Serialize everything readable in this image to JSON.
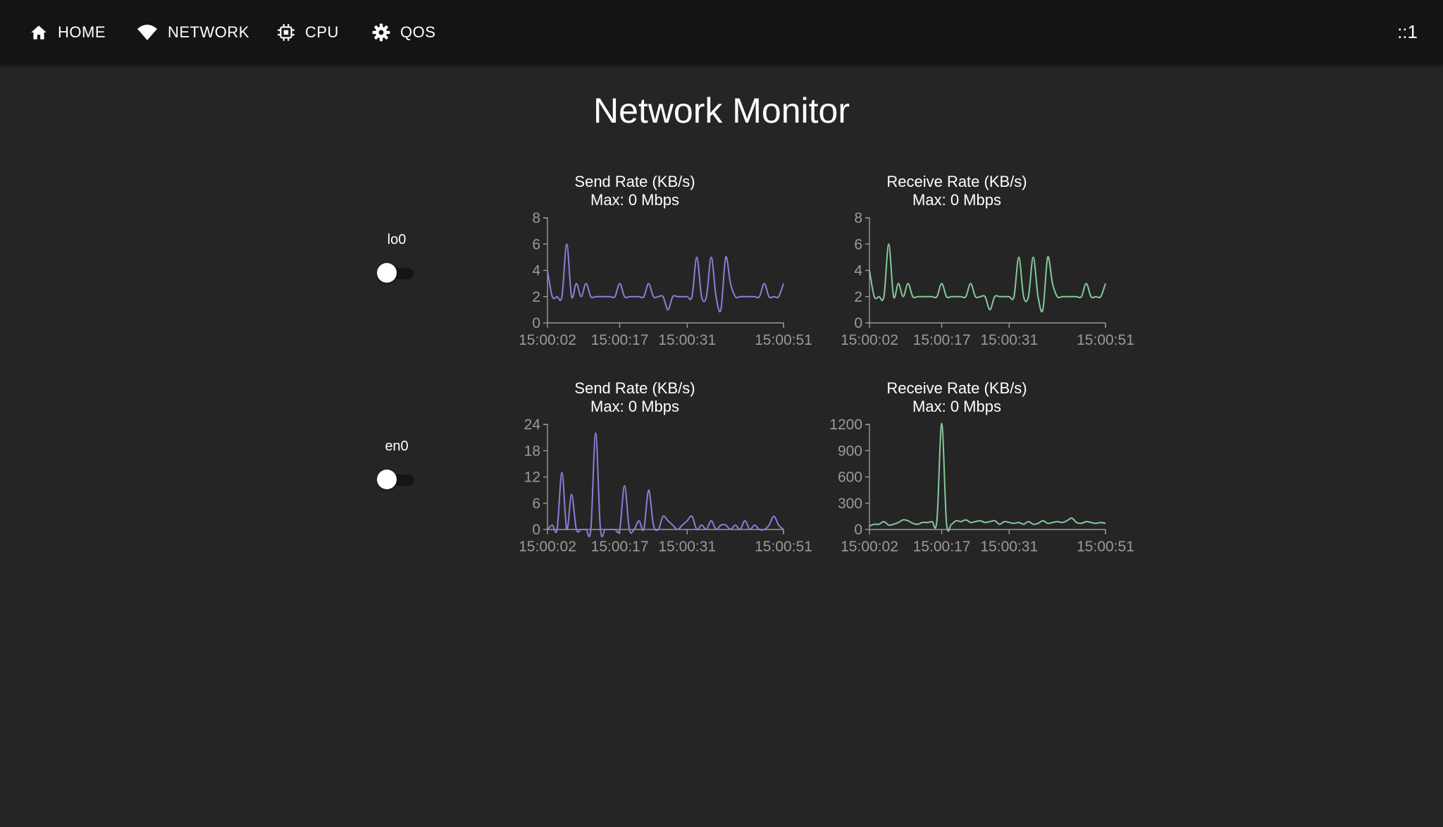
{
  "nav": {
    "items": [
      {
        "label": "HOME",
        "icon": "home-icon"
      },
      {
        "label": "NETWORK",
        "icon": "wifi-icon"
      },
      {
        "label": "CPU",
        "icon": "cpu-chip-icon"
      },
      {
        "label": "QOS",
        "icon": "gear-icon"
      }
    ],
    "host": "::1"
  },
  "page": {
    "title": "Network Monitor"
  },
  "colors": {
    "background": "#252525",
    "topbar": "#141414",
    "send_line": "#8b7fd8",
    "receive_line": "#86c99b"
  },
  "interfaces": [
    {
      "name": "lo0",
      "toggle_on": false,
      "send": {
        "title": "Send Rate (KB/s)",
        "subtitle": "Max: 0 Mbps"
      },
      "receive": {
        "title": "Receive Rate (KB/s)",
        "subtitle": "Max: 0 Mbps"
      }
    },
    {
      "name": "en0",
      "toggle_on": false,
      "send": {
        "title": "Send Rate (KB/s)",
        "subtitle": "Max: 0 Mbps"
      },
      "receive": {
        "title": "Receive Rate (KB/s)",
        "subtitle": "Max: 0 Mbps"
      }
    }
  ],
  "chart_data": [
    {
      "type": "line",
      "title": "Send Rate (KB/s)",
      "x_ticks": [
        "15:00:02",
        "15:00:17",
        "15:00:31",
        "15:00:51"
      ],
      "ylim": [
        0,
        8
      ],
      "y_ticks": [
        0,
        2,
        4,
        6,
        8
      ],
      "color": "#8b7fd8",
      "x": [
        2,
        3,
        4,
        5,
        6,
        7,
        8,
        9,
        10,
        11,
        12,
        13,
        14,
        15,
        16,
        17,
        18,
        19,
        20,
        21,
        22,
        23,
        24,
        25,
        26,
        27,
        28,
        29,
        30,
        31,
        32,
        33,
        34,
        35,
        36,
        37,
        38,
        39,
        40,
        41,
        42,
        43,
        44,
        45,
        46,
        47,
        48,
        49,
        50,
        51
      ],
      "values": [
        4,
        2,
        2,
        2,
        6,
        2,
        3,
        2,
        3,
        2,
        2,
        2,
        2,
        2,
        2,
        3,
        2,
        2,
        2,
        2,
        2,
        3,
        2,
        2,
        2,
        1,
        2,
        2,
        2,
        2,
        2,
        5,
        2,
        2,
        5,
        2,
        1,
        5,
        3,
        2,
        2,
        2,
        2,
        2,
        2,
        3,
        2,
        2,
        2,
        3
      ]
    },
    {
      "type": "line",
      "title": "Receive Rate (KB/s)",
      "x_ticks": [
        "15:00:02",
        "15:00:17",
        "15:00:31",
        "15:00:51"
      ],
      "ylim": [
        0,
        8
      ],
      "y_ticks": [
        0,
        2,
        4,
        6,
        8
      ],
      "color": "#86c99b",
      "x": [
        2,
        3,
        4,
        5,
        6,
        7,
        8,
        9,
        10,
        11,
        12,
        13,
        14,
        15,
        16,
        17,
        18,
        19,
        20,
        21,
        22,
        23,
        24,
        25,
        26,
        27,
        28,
        29,
        30,
        31,
        32,
        33,
        34,
        35,
        36,
        37,
        38,
        39,
        40,
        41,
        42,
        43,
        44,
        45,
        46,
        47,
        48,
        49,
        50,
        51
      ],
      "values": [
        4,
        2,
        2,
        2,
        6,
        2,
        3,
        2,
        3,
        2,
        2,
        2,
        2,
        2,
        2,
        3,
        2,
        2,
        2,
        2,
        2,
        3,
        2,
        2,
        2,
        1,
        2,
        2,
        2,
        2,
        2,
        5,
        2,
        2,
        5,
        2,
        1,
        5,
        3,
        2,
        2,
        2,
        2,
        2,
        2,
        3,
        2,
        2,
        2,
        3
      ]
    },
    {
      "type": "line",
      "title": "Send Rate (KB/s)",
      "x_ticks": [
        "15:00:02",
        "15:00:17",
        "15:00:31",
        "15:00:51"
      ],
      "ylim": [
        0,
        24
      ],
      "y_ticks": [
        0,
        6,
        12,
        18,
        24
      ],
      "color": "#8b7fd8",
      "x": [
        2,
        3,
        4,
        5,
        6,
        7,
        8,
        9,
        10,
        11,
        12,
        13,
        14,
        15,
        16,
        17,
        18,
        19,
        20,
        21,
        22,
        23,
        24,
        25,
        26,
        27,
        28,
        29,
        30,
        31,
        32,
        33,
        34,
        35,
        36,
        37,
        38,
        39,
        40,
        41,
        42,
        43,
        44,
        45,
        46,
        47,
        48,
        49,
        50,
        51
      ],
      "values": [
        0,
        1,
        0,
        13,
        0,
        8,
        0,
        0,
        0,
        0,
        22,
        0,
        0,
        0,
        0,
        0,
        10,
        0,
        0,
        2,
        0,
        9,
        1,
        0,
        3,
        2,
        1,
        0,
        1,
        2,
        3,
        0,
        1,
        0,
        2,
        0,
        1,
        1,
        0,
        1,
        0,
        2,
        0,
        1,
        0,
        0,
        1,
        3,
        1,
        0
      ]
    },
    {
      "type": "line",
      "title": "Receive Rate (KB/s)",
      "x_ticks": [
        "15:00:02",
        "15:00:17",
        "15:00:31",
        "15:00:51"
      ],
      "ylim": [
        0,
        1200
      ],
      "y_ticks": [
        0,
        300,
        600,
        900,
        1200
      ],
      "color": "#86c99b",
      "x": [
        2,
        3,
        4,
        5,
        6,
        7,
        8,
        9,
        10,
        11,
        12,
        13,
        14,
        15,
        16,
        17,
        18,
        19,
        20,
        21,
        22,
        23,
        24,
        25,
        26,
        27,
        28,
        29,
        30,
        31,
        32,
        33,
        34,
        35,
        36,
        37,
        38,
        39,
        40,
        41,
        42,
        43,
        44,
        45,
        46,
        47,
        48,
        49,
        50,
        51
      ],
      "values": [
        40,
        60,
        60,
        90,
        50,
        60,
        80,
        110,
        100,
        70,
        60,
        80,
        80,
        90,
        100,
        1210,
        70,
        60,
        100,
        90,
        110,
        80,
        90,
        100,
        80,
        90,
        100,
        60,
        90,
        80,
        70,
        80,
        60,
        90,
        60,
        70,
        100,
        70,
        80,
        90,
        80,
        100,
        130,
        80,
        70,
        90,
        80,
        70,
        80,
        70
      ]
    }
  ]
}
